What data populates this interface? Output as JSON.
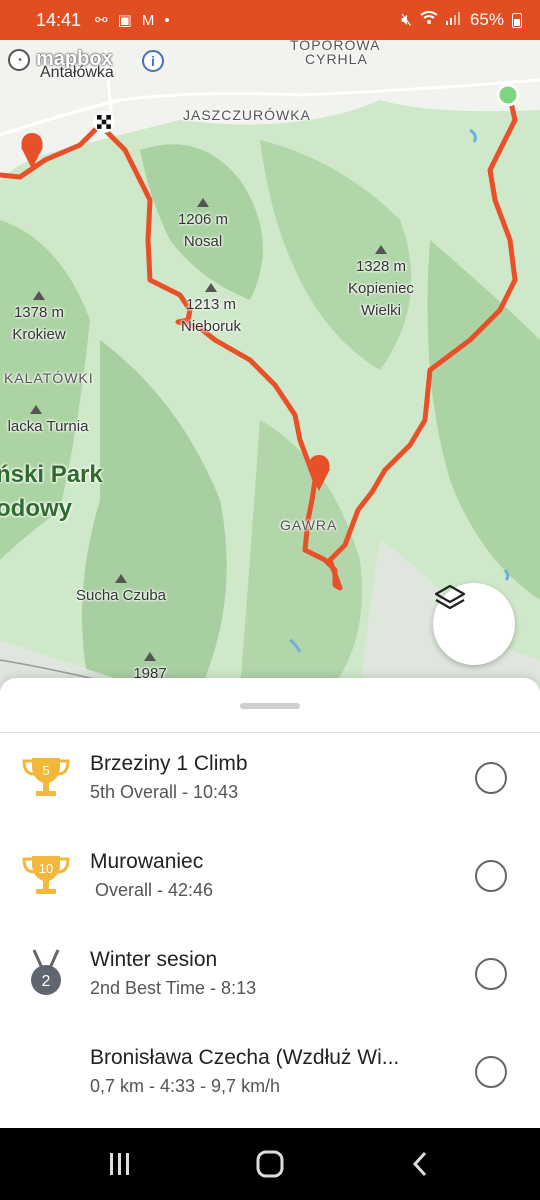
{
  "status_bar": {
    "time": "14:41",
    "battery": "65%",
    "left_icons": [
      "link-icon",
      "image-icon",
      "gmail-icon",
      "dot-icon"
    ],
    "right_icons": [
      "mute-icon",
      "wifi-icon",
      "signal-icon",
      "battery-icon"
    ]
  },
  "map": {
    "attribution": "mapbox",
    "places": {
      "antalowka": "Antałówka",
      "cyrhla": "CYRHLA",
      "toporowa": "TOPOROWA",
      "jaszczurowka": "JASZCZURÓWKA",
      "kalatowki": "KALATÓWKI",
      "gawra": "GAWRA"
    },
    "peaks": {
      "nosal_height": "1206 m",
      "nosal_name": "Nosal",
      "kopieniec_height": "1328 m",
      "kopieniec_name": "Kopieniec Wielki",
      "krokiew_height": "1378 m",
      "krokiew_name": "Krokiew",
      "niebor_height": "1213 m",
      "niebor_name": "Nieboruk",
      "turnia_name": "lacka Turnia",
      "sucha_name": "Sucha Czuba",
      "bottom_height": "1987"
    },
    "park_label": "ński Park\nodowy",
    "route_color": "#e8502a",
    "start_color": "#7fd47f"
  },
  "segments": [
    {
      "title": "Brzeziny 1 Climb",
      "subtitle": "5th Overall - 10:43",
      "icon": "gold-trophy-icon",
      "rank": "5"
    },
    {
      "title": "Murowaniec",
      "subtitle": " Overall - 42:46",
      "icon": "gold-trophy-icon",
      "rank": "10"
    },
    {
      "title": "Winter sesion",
      "subtitle": "2nd Best Time - 8:13",
      "icon": "silver-medal-icon",
      "rank": "2"
    },
    {
      "title": "Bronisława Czecha (Wzdłuż Wi...",
      "subtitle": "0,7 km - 4:33 - 9,7 km/h",
      "icon": "",
      "rank": ""
    }
  ],
  "nav": [
    "recent-apps-icon",
    "home-icon",
    "back-icon"
  ]
}
